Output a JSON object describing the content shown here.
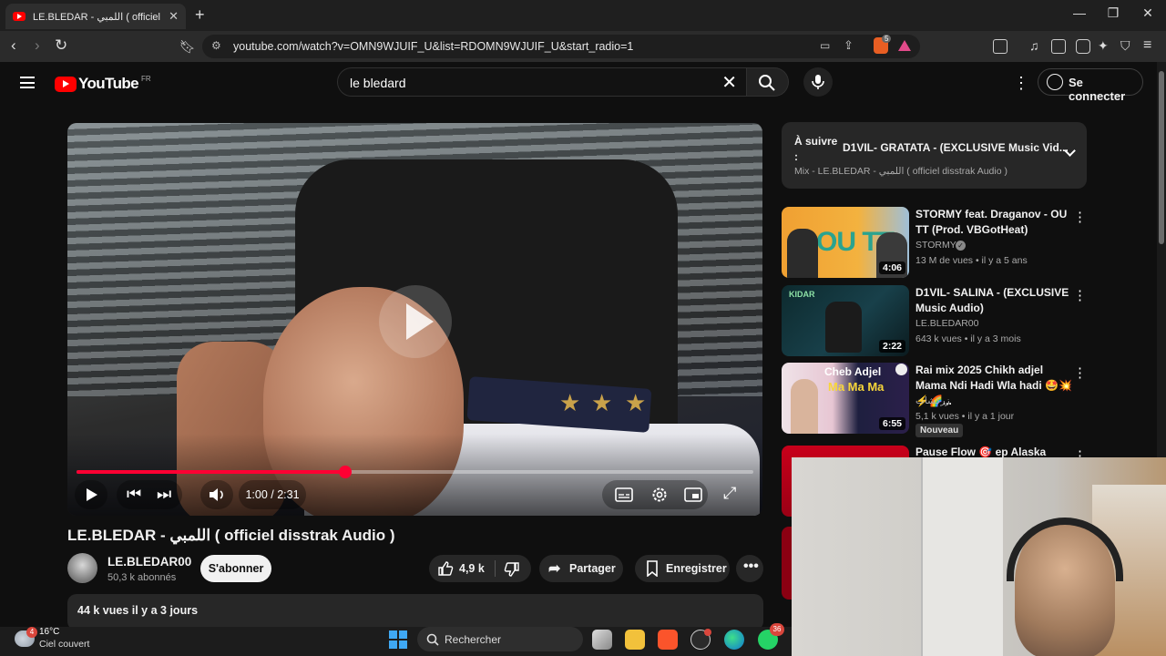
{
  "browser": {
    "tab_title": "LE.BLEDAR - اللمبي ( officiel disstrak",
    "url": "youtube.com/watch?v=OMN9WJUIF_U&list=RDOMN9WJUIF_U&start_radio=1",
    "shield_badge": "5"
  },
  "header": {
    "logo_text": "YouTube",
    "country_code": "FR",
    "search_query": "le bledard",
    "signin_label": "Se connecter"
  },
  "player": {
    "current_time": "1:00",
    "duration": "2:31",
    "time_display": "1:00 / 2:31",
    "progress_fraction": 0.397,
    "accent_color": "#ff0033"
  },
  "video": {
    "title": "LE.BLEDAR - اللمبي ( officiel disstrak Audio )",
    "channel_name": "LE.BLEDAR00",
    "subscribers": "50,3 k abonnés",
    "subscribe_label": "S'abonner",
    "like_count": "4,9 k",
    "share_label": "Partager",
    "save_label": "Enregistrer",
    "views_date": "44 k vues  il y a 3 jours"
  },
  "up_next": {
    "label": "À suivre :",
    "title": "D1VIL- GRATATA - (EXCLUSIVE Music Vid...",
    "subtitle": "Mix - LE.BLEDAR - اللمبي ( officiel disstrak Audio )"
  },
  "recommendations": [
    {
      "title": "STORMY feat. Draganov - OU TT (Prod. VBGotHeat)",
      "channel": "STORMY",
      "verified": true,
      "meta": "13 M de vues • il y a 5 ans",
      "duration": "4:06",
      "thumb_text": "OU TT"
    },
    {
      "title": "D1VIL- SALINA - (EXCLUSIVE Music Audio)",
      "channel": "LE.BLEDAR00",
      "meta": "643 k vues • il y a 3 mois",
      "duration": "2:22",
      "thumb_text": "KIDAR"
    },
    {
      "title": "Rai mix 2025 Chikh adjel Mama Ndi Hadi Wla hadi 🤩💥⚡🌈...",
      "channel": "زركشات",
      "meta": "5,1 k vues • il y a 1 jour",
      "duration": "6:55",
      "badge": "Nouveau",
      "thumb_line1": "Cheb Adjel",
      "thumb_line2": "Ma Ma Ma"
    },
    {
      "title": "Pause Flow 🎯 ep Alaska"
    }
  ],
  "taskbar": {
    "temperature": "16°C",
    "weather": "Ciel couvert",
    "weather_badge": "4",
    "search_label": "Rechercher",
    "whatsapp_badge": "36"
  }
}
